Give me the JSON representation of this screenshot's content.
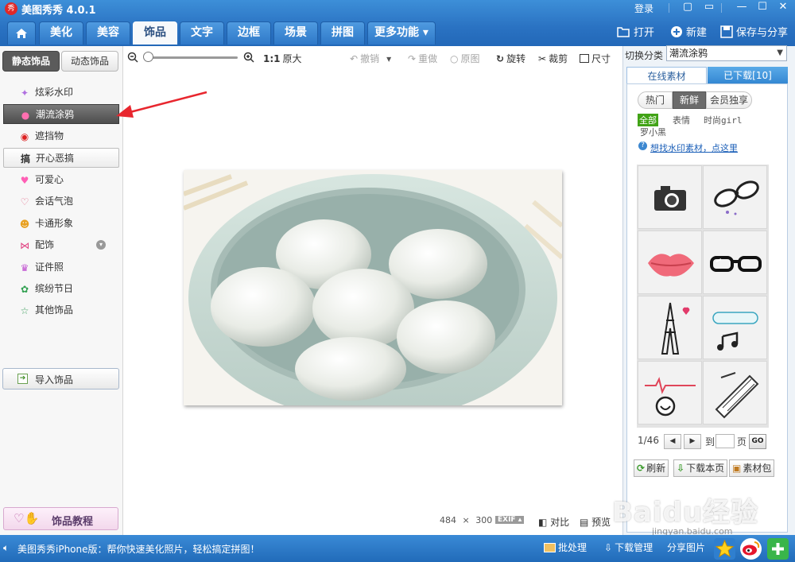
{
  "app": {
    "logo_text": "秀",
    "title": "美图秀秀 4.0.1",
    "login": "登录"
  },
  "window_controls": {
    "minimize": "—",
    "maximize": "☐",
    "close": "✕"
  },
  "main_tabs": [
    {
      "label": ""
    },
    {
      "label": "美化"
    },
    {
      "label": "美容"
    },
    {
      "label": "饰品"
    },
    {
      "label": "文字"
    },
    {
      "label": "边框"
    },
    {
      "label": "场景"
    },
    {
      "label": "拼图"
    },
    {
      "label": "更多功能 ▾"
    }
  ],
  "active_tab": "饰品",
  "top_actions": {
    "open": "打开",
    "new": "新建",
    "save": "保存与分享"
  },
  "left": {
    "subtabs": [
      {
        "label": "静态饰品"
      },
      {
        "label": "动态饰品"
      }
    ],
    "categories": [
      {
        "label": "炫彩水印",
        "icon": "sparkle-icon"
      },
      {
        "label": "潮流涂鸦",
        "icon": "lips-icon"
      },
      {
        "label": "遮挡物",
        "icon": "mask-icon"
      },
      {
        "label": "开心恶搞",
        "icon": "prank-icon"
      },
      {
        "label": "可爱心",
        "icon": "heart-icon"
      },
      {
        "label": "会话气泡",
        "icon": "bubble-icon"
      },
      {
        "label": "卡通形象",
        "icon": "cartoon-icon"
      },
      {
        "label": "配饰",
        "icon": "bow-icon"
      },
      {
        "label": "证件照",
        "icon": "idphoto-icon"
      },
      {
        "label": "缤纷节日",
        "icon": "gift-icon"
      },
      {
        "label": "其他饰品",
        "icon": "star-icon"
      }
    ],
    "selected_category": "潮流涂鸦",
    "import_label": "导入饰品",
    "tutorial_label": "饰品教程"
  },
  "toolbar": {
    "ratio": "1:1",
    "original_size": "原大",
    "undo": "撤销",
    "redo": "重做",
    "original": "原图",
    "rotate": "旋转",
    "crop": "裁剪",
    "size": "尺寸"
  },
  "canvas": {
    "width": "484",
    "times": "×",
    "height": "300",
    "exif": "EXIF ▴",
    "compare": "对比",
    "preview": "预览"
  },
  "right": {
    "switch_label": "切换分类",
    "switch_value": "潮流涂鸦",
    "tabs": [
      {
        "label": "在线素材"
      },
      {
        "label": "已下载[10]"
      }
    ],
    "pills": [
      {
        "label": "热门"
      },
      {
        "label": "新鲜"
      },
      {
        "label": "会员独享"
      }
    ],
    "filters": [
      {
        "label": "全部"
      },
      {
        "label": "表情"
      },
      {
        "label": "时尚girl"
      },
      {
        "label": "罗小黑"
      }
    ],
    "help_link": "想找水印素材，点这里",
    "stickers": [
      "camera",
      "sunglasses",
      "lips",
      "glasses",
      "eiffel-tower",
      "music-note",
      "heartbeat",
      "keyboard"
    ],
    "pager": {
      "current": "1/46",
      "to": "到",
      "page": "页",
      "go": "GO"
    },
    "actions": {
      "refresh": "刷新",
      "download_page": "下载本页",
      "package": "素材包"
    }
  },
  "bottom": {
    "promo": "美图秀秀iPhone版：帮你快速美化照片，轻松搞定拼图！",
    "batch": "批处理",
    "download_manager": "下载管理",
    "share": "分享图片"
  },
  "watermark": {
    "brand": "Baidu经验",
    "url": "jingyan.baidu.com"
  },
  "colors": {
    "titlebar": "#2a72c2",
    "selected_item": "#5b5b5b",
    "filter_active": "#41a316",
    "arrow": "#e8262e"
  }
}
